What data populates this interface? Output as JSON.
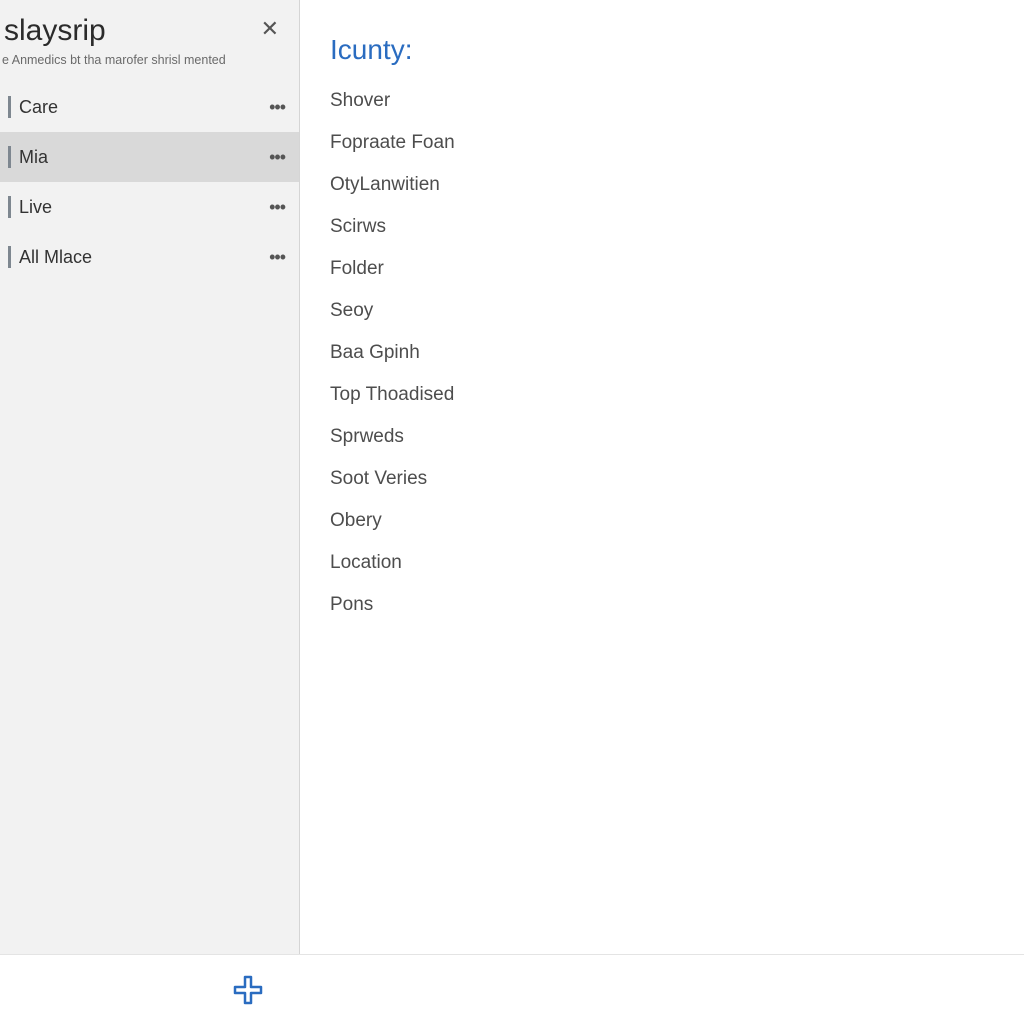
{
  "sidebar": {
    "title": "slaysrip",
    "subtitle": "e Anmedics bt tha marofer shrisl mented",
    "items": [
      {
        "label": "Care",
        "selected": false
      },
      {
        "label": "Mia",
        "selected": true
      },
      {
        "label": "Live",
        "selected": false
      },
      {
        "label": "All Mlace",
        "selected": false
      }
    ]
  },
  "main": {
    "heading": "Icunty:",
    "items": [
      "Shover",
      "Fopraate Foan",
      "OtyLanwitien",
      "Scirws",
      "Folder",
      "Seoy",
      "Baa Gpinh",
      "Top Thoadised",
      "Sprweds",
      "Soot Veries",
      "Obery",
      "Location",
      "Pons"
    ]
  }
}
